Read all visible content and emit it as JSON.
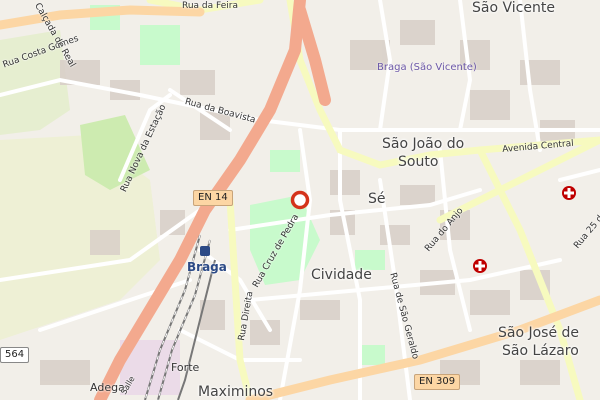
{
  "map": {
    "place_labels": {
      "sao_vicente": "São Vicente",
      "braga_sao_vicente": "Braga (São Vicente)",
      "sao_joao_do_souto_1": "São João do",
      "sao_joao_do_souto_2": "Souto",
      "se": "Sé",
      "cividade": "Cividade",
      "sao_jose_1": "São José de",
      "sao_jose_2": "São Lázaro",
      "maximinos": "Maximinos",
      "forte": "Forte",
      "adega": "Adega"
    },
    "street_labels": {
      "rua_da_feira": "Rua da Feira",
      "rua_costa_gomes": "Rua Costa Gomes",
      "calcada_de_real": "Calçada de Real",
      "rua_da_boavista": "Rua da Boavista",
      "rua_nova_da_estacao": "Rua Nova da Estação",
      "avenida_central": "Avenida Central",
      "rua_do_anjo": "Rua do Anjo",
      "rua_cruz_de_pedra": "Rua Cruz de Pedra",
      "rua_direita": "Rua Direita",
      "rua_de_sao_geraldo": "Rua de São Geraldo",
      "rua_25_de": "Rua 25 de",
      "salle": "Salle"
    },
    "road_shields": {
      "en14": "EN 14",
      "en309": "EN 309",
      "n564": "564"
    },
    "station": {
      "name": "Braga"
    },
    "colors": {
      "background": "#f2efe9",
      "trunk_road": "#f3a98e",
      "primary_road": "#fcd6a4",
      "secondary_road": "#f7fabf",
      "park": "#c8facc",
      "building": "#d9d0c9",
      "marker": "#d4331b",
      "hospital": "#bf0000"
    },
    "icons": [
      "location-pin-icon",
      "hospital-icon",
      "train-station-icon"
    ]
  }
}
